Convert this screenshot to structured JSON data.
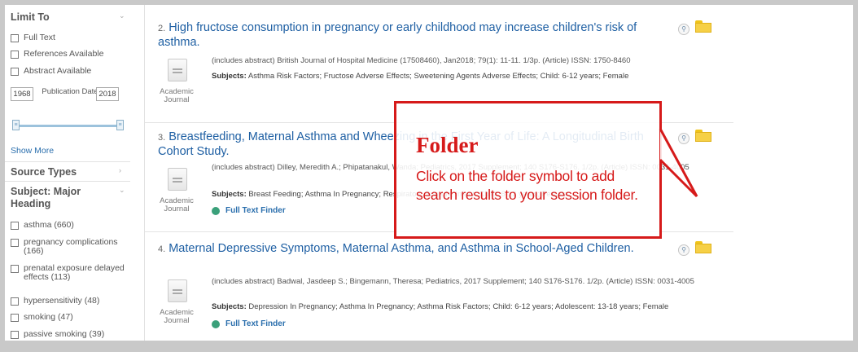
{
  "sidebar": {
    "limit_to": {
      "heading": "Limit To",
      "options": [
        "Full Text",
        "References Available",
        "Abstract Available"
      ],
      "year_from": "1968",
      "year_to": "2018",
      "publication_date_label": "Publication Date",
      "show_more": "Show More"
    },
    "source_types": {
      "heading": "Source Types"
    },
    "subject_major": {
      "heading": "Subject: Major Heading",
      "items": [
        "asthma (660)",
        "pregnancy complications (166)",
        "prenatal exposure delayed effects (113)",
        "hypersensitivity (48)",
        "smoking (47)",
        "passive smoking (39)"
      ]
    }
  },
  "results": [
    {
      "number": "2.",
      "title": "High fructose consumption in pregnancy or early childhood may increase children's risk of asthma.",
      "meta": "(includes abstract) British Journal of Hospital Medicine (17508460), Jan2018; 79(1): 11-11. 1/3p. (Article) ISSN: 1750-8460",
      "subjects_label": "Subjects:",
      "subjects": "Asthma Risk Factors; Fructose Adverse Effects; Sweetening Agents Adverse Effects; Child: 6-12 years; Female",
      "type": "Academic Journal"
    },
    {
      "number": "3.",
      "title": "Breastfeeding, Maternal Asthma and Wheezing in the First Year of Life: A Longitudinal Birth Cohort Study.",
      "meta": "(includes abstract) Dilley, Meredith A.; Phipatanakul, Wanda; Pediatrics, 2017 Supplement; 140 S176-S176. 1/2p. (Article) ISSN: 0031-4005",
      "subjects_label": "Subjects:",
      "subjects": "Breast Feeding; Asthma In Pregnancy; Respiratory Sounds; Infant; Child: 6-12 years; Female",
      "type": "Academic Journal",
      "full_text": "Full Text Finder"
    },
    {
      "number": "4.",
      "title": "Maternal Depressive Symptoms, Maternal Asthma, and Asthma in School-Aged Children.",
      "meta": "(includes abstract) Badwal, Jasdeep S.; Bingemann, Theresa; Pediatrics, 2017 Supplement; 140 S176-S176. 1/2p. (Article) ISSN: 0031-4005",
      "subjects_label": "Subjects:",
      "subjects": "Depression In Pregnancy; Asthma In Pregnancy; Asthma Risk Factors; Child: 6-12 years; Adolescent: 13-18 years; Female",
      "type": "Academic Journal",
      "full_text": "Full Text Finder"
    }
  ],
  "callout": {
    "title": "Folder",
    "body": "Click on the folder symbol to add search results to your session folder."
  },
  "colors": {
    "accent_red": "#d61a1a",
    "link_blue": "#1e5fa3",
    "folder_yellow": "#f6d046"
  },
  "icons": [
    "document-icon",
    "preview-icon",
    "folder-icon",
    "full-text-finder-icon",
    "chevron-down-icon",
    "chevron-right-icon"
  ]
}
